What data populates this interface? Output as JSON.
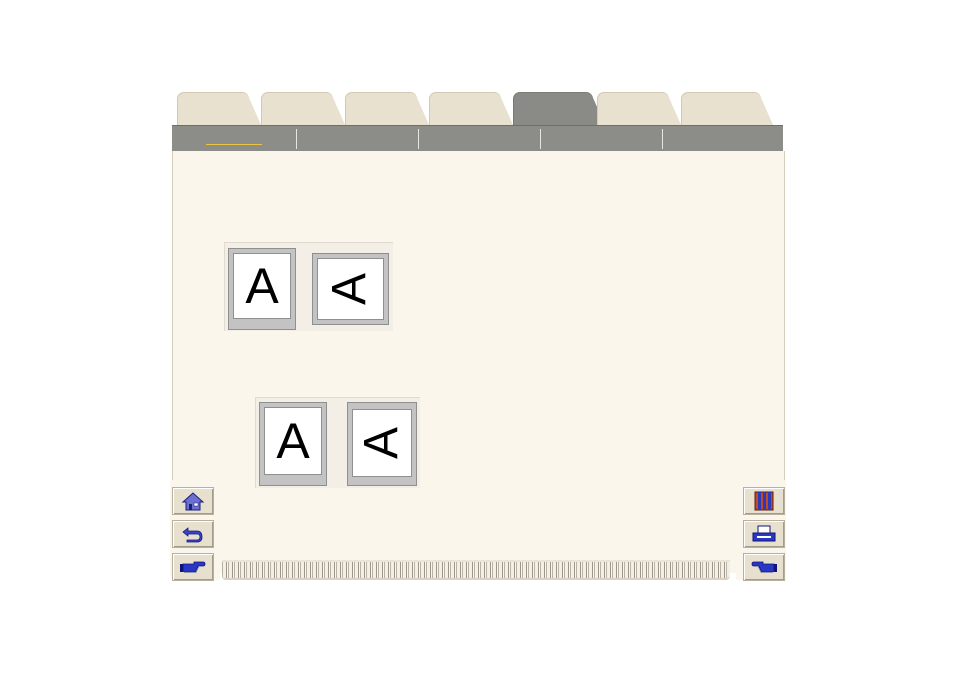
{
  "colors": {
    "tab_inactive": "#e9e1d0",
    "tab_active": "#8a8a86",
    "content_bg": "#fbf6ec",
    "subtab_underline": "#e8c640",
    "button_icon": "#2233aa"
  },
  "tabs": [
    {
      "label": "",
      "active": false
    },
    {
      "label": "",
      "active": false
    },
    {
      "label": "",
      "active": false
    },
    {
      "label": "",
      "active": false
    },
    {
      "label": "",
      "active": true
    },
    {
      "label": "",
      "active": false
    },
    {
      "label": "",
      "active": false
    }
  ],
  "subtabs": [
    {
      "label": "",
      "selected": true
    },
    {
      "label": "",
      "selected": false
    },
    {
      "label": "",
      "selected": false
    },
    {
      "label": "",
      "selected": false
    },
    {
      "label": "",
      "selected": false
    }
  ],
  "illustrations": {
    "group1": {
      "upright_letter": "A",
      "rotated_letter": "A"
    },
    "group2": {
      "upright_letter": "A",
      "rotated_letter": "A"
    }
  },
  "left_nav": [
    {
      "icon": "home-icon"
    },
    {
      "icon": "back-arrow-icon"
    },
    {
      "icon": "pointing-hand-right-icon"
    }
  ],
  "right_nav": [
    {
      "icon": "book-index-icon"
    },
    {
      "icon": "printer-icon"
    },
    {
      "icon": "pointing-hand-left-icon"
    }
  ]
}
